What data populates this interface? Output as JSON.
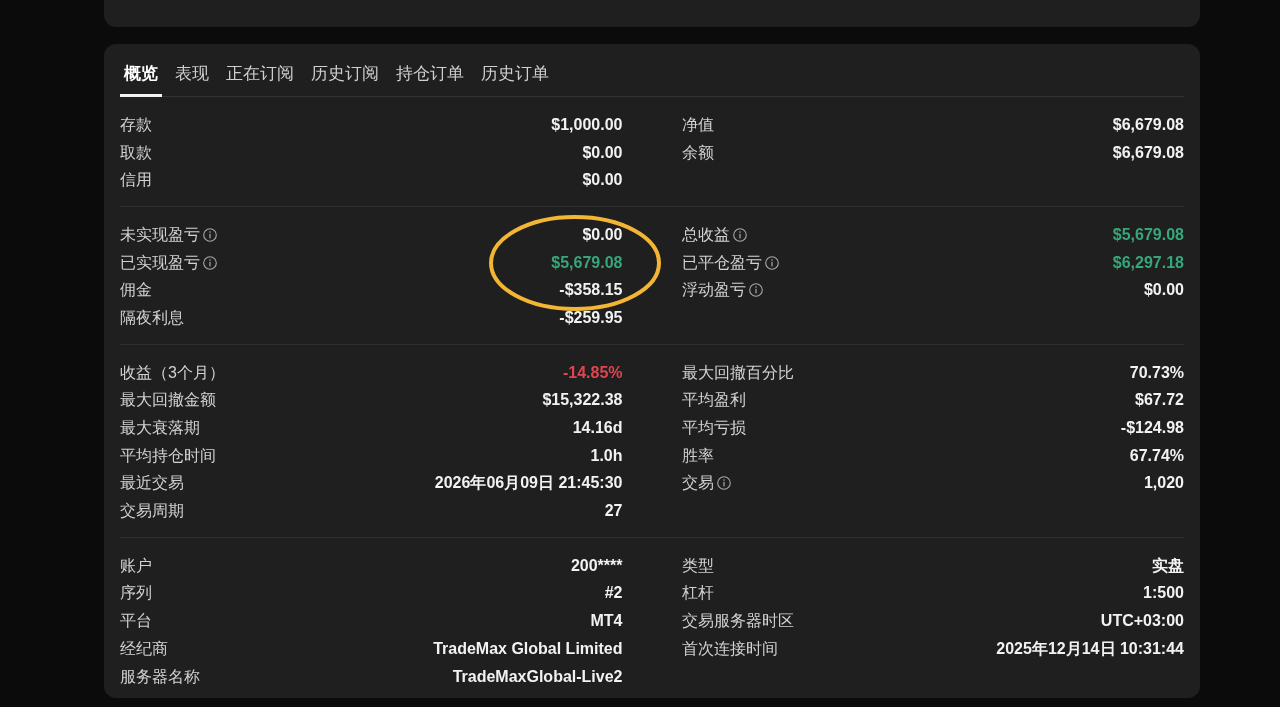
{
  "tabs": [
    {
      "label": "概览",
      "selected": true
    },
    {
      "label": "表现",
      "selected": false
    },
    {
      "label": "正在订阅",
      "selected": false
    },
    {
      "label": "历史订阅",
      "selected": false
    },
    {
      "label": "持仓订单",
      "selected": false
    },
    {
      "label": "历史订单",
      "selected": false
    }
  ],
  "sections": [
    {
      "left": [
        {
          "label": "存款",
          "value": "$1,000.00"
        },
        {
          "label": "取款",
          "value": "$0.00"
        },
        {
          "label": "信用",
          "value": "$0.00"
        }
      ],
      "right": [
        {
          "label": "净值",
          "value": "$6,679.08"
        },
        {
          "label": "余额",
          "value": "$6,679.08"
        }
      ]
    },
    {
      "left": [
        {
          "label": "未实现盈亏",
          "value": "$0.00",
          "info": true
        },
        {
          "label": "已实现盈亏",
          "value": "$5,679.08",
          "color": "#37a67a",
          "info": true,
          "circled": true
        },
        {
          "label": "佣金",
          "value": "-$358.15"
        },
        {
          "label": "隔夜利息",
          "value": "-$259.95"
        }
      ],
      "right": [
        {
          "label": "总收益",
          "value": "$5,679.08",
          "color": "#37a67a",
          "info": true
        },
        {
          "label": "已平仓盈亏",
          "value": "$6,297.18",
          "color": "#37a67a",
          "info": true
        },
        {
          "label": "浮动盈亏",
          "value": "$0.00",
          "info": true
        }
      ]
    },
    {
      "left": [
        {
          "label": "收益（3个月）",
          "value": "-14.85%",
          "color": "#e0454f"
        },
        {
          "label": "最大回撤金额",
          "value": "$15,322.38"
        },
        {
          "label": "最大衰落期",
          "value": "14.16d"
        },
        {
          "label": "平均持仓时间",
          "value": "1.0h"
        },
        {
          "label": "最近交易",
          "value": "2026年06月09日 21:45:30"
        },
        {
          "label": "交易周期",
          "value": "27"
        }
      ],
      "right": [
        {
          "label": "最大回撤百分比",
          "value": "70.73%"
        },
        {
          "label": "平均盈利",
          "value": "$67.72"
        },
        {
          "label": "平均亏损",
          "value": "-$124.98"
        },
        {
          "label": "胜率",
          "value": "67.74%"
        },
        {
          "label": "交易",
          "value": "1,020",
          "info": true
        }
      ]
    },
    {
      "left": [
        {
          "label": "账户",
          "value": "200****"
        },
        {
          "label": "序列",
          "value": "#2"
        },
        {
          "label": "平台",
          "value": "MT4"
        },
        {
          "label": "经纪商",
          "value": "TradeMax Global Limited"
        },
        {
          "label": "服务器名称",
          "value": "TradeMaxGlobal-Live2"
        }
      ],
      "right": [
        {
          "label": "类型",
          "value": "实盘"
        },
        {
          "label": "杠杆",
          "value": "1:500"
        },
        {
          "label": "交易服务器时区",
          "value": "UTC+03:00"
        },
        {
          "label": "首次连接时间",
          "value": "2025年12月14日 10:31:44"
        }
      ]
    }
  ]
}
